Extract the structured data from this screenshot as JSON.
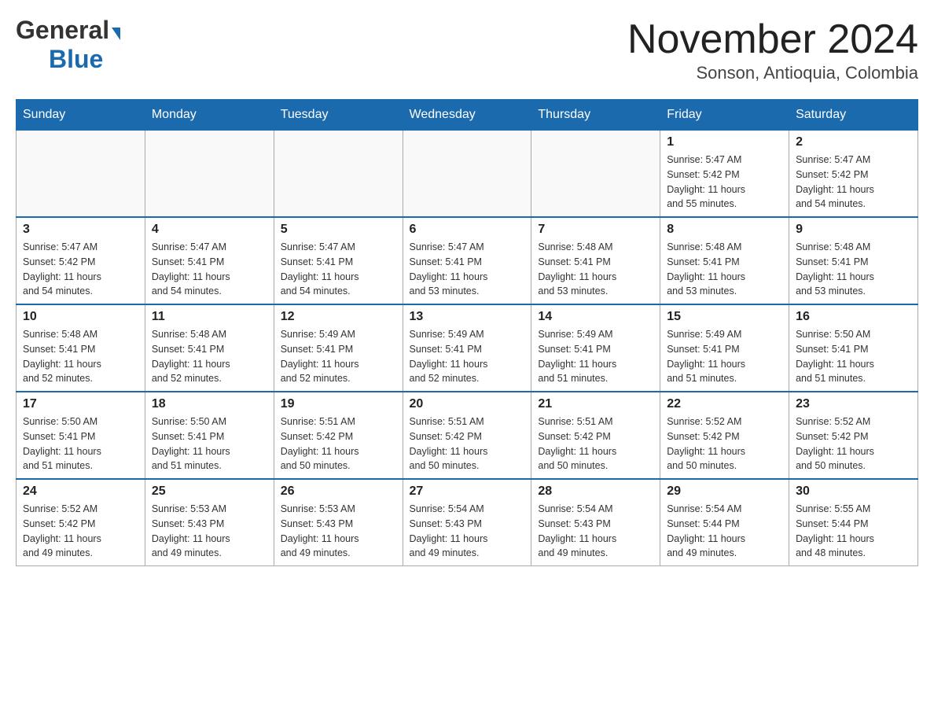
{
  "header": {
    "logo_general": "General",
    "logo_blue": "Blue",
    "month_title": "November 2024",
    "location": "Sonson, Antioquia, Colombia"
  },
  "days_of_week": [
    "Sunday",
    "Monday",
    "Tuesday",
    "Wednesday",
    "Thursday",
    "Friday",
    "Saturday"
  ],
  "weeks": [
    {
      "days": [
        {
          "num": "",
          "info": ""
        },
        {
          "num": "",
          "info": ""
        },
        {
          "num": "",
          "info": ""
        },
        {
          "num": "",
          "info": ""
        },
        {
          "num": "",
          "info": ""
        },
        {
          "num": "1",
          "info": "Sunrise: 5:47 AM\nSunset: 5:42 PM\nDaylight: 11 hours\nand 55 minutes."
        },
        {
          "num": "2",
          "info": "Sunrise: 5:47 AM\nSunset: 5:42 PM\nDaylight: 11 hours\nand 54 minutes."
        }
      ]
    },
    {
      "days": [
        {
          "num": "3",
          "info": "Sunrise: 5:47 AM\nSunset: 5:42 PM\nDaylight: 11 hours\nand 54 minutes."
        },
        {
          "num": "4",
          "info": "Sunrise: 5:47 AM\nSunset: 5:41 PM\nDaylight: 11 hours\nand 54 minutes."
        },
        {
          "num": "5",
          "info": "Sunrise: 5:47 AM\nSunset: 5:41 PM\nDaylight: 11 hours\nand 54 minutes."
        },
        {
          "num": "6",
          "info": "Sunrise: 5:47 AM\nSunset: 5:41 PM\nDaylight: 11 hours\nand 53 minutes."
        },
        {
          "num": "7",
          "info": "Sunrise: 5:48 AM\nSunset: 5:41 PM\nDaylight: 11 hours\nand 53 minutes."
        },
        {
          "num": "8",
          "info": "Sunrise: 5:48 AM\nSunset: 5:41 PM\nDaylight: 11 hours\nand 53 minutes."
        },
        {
          "num": "9",
          "info": "Sunrise: 5:48 AM\nSunset: 5:41 PM\nDaylight: 11 hours\nand 53 minutes."
        }
      ]
    },
    {
      "days": [
        {
          "num": "10",
          "info": "Sunrise: 5:48 AM\nSunset: 5:41 PM\nDaylight: 11 hours\nand 52 minutes."
        },
        {
          "num": "11",
          "info": "Sunrise: 5:48 AM\nSunset: 5:41 PM\nDaylight: 11 hours\nand 52 minutes."
        },
        {
          "num": "12",
          "info": "Sunrise: 5:49 AM\nSunset: 5:41 PM\nDaylight: 11 hours\nand 52 minutes."
        },
        {
          "num": "13",
          "info": "Sunrise: 5:49 AM\nSunset: 5:41 PM\nDaylight: 11 hours\nand 52 minutes."
        },
        {
          "num": "14",
          "info": "Sunrise: 5:49 AM\nSunset: 5:41 PM\nDaylight: 11 hours\nand 51 minutes."
        },
        {
          "num": "15",
          "info": "Sunrise: 5:49 AM\nSunset: 5:41 PM\nDaylight: 11 hours\nand 51 minutes."
        },
        {
          "num": "16",
          "info": "Sunrise: 5:50 AM\nSunset: 5:41 PM\nDaylight: 11 hours\nand 51 minutes."
        }
      ]
    },
    {
      "days": [
        {
          "num": "17",
          "info": "Sunrise: 5:50 AM\nSunset: 5:41 PM\nDaylight: 11 hours\nand 51 minutes."
        },
        {
          "num": "18",
          "info": "Sunrise: 5:50 AM\nSunset: 5:41 PM\nDaylight: 11 hours\nand 51 minutes."
        },
        {
          "num": "19",
          "info": "Sunrise: 5:51 AM\nSunset: 5:42 PM\nDaylight: 11 hours\nand 50 minutes."
        },
        {
          "num": "20",
          "info": "Sunrise: 5:51 AM\nSunset: 5:42 PM\nDaylight: 11 hours\nand 50 minutes."
        },
        {
          "num": "21",
          "info": "Sunrise: 5:51 AM\nSunset: 5:42 PM\nDaylight: 11 hours\nand 50 minutes."
        },
        {
          "num": "22",
          "info": "Sunrise: 5:52 AM\nSunset: 5:42 PM\nDaylight: 11 hours\nand 50 minutes."
        },
        {
          "num": "23",
          "info": "Sunrise: 5:52 AM\nSunset: 5:42 PM\nDaylight: 11 hours\nand 50 minutes."
        }
      ]
    },
    {
      "days": [
        {
          "num": "24",
          "info": "Sunrise: 5:52 AM\nSunset: 5:42 PM\nDaylight: 11 hours\nand 49 minutes."
        },
        {
          "num": "25",
          "info": "Sunrise: 5:53 AM\nSunset: 5:43 PM\nDaylight: 11 hours\nand 49 minutes."
        },
        {
          "num": "26",
          "info": "Sunrise: 5:53 AM\nSunset: 5:43 PM\nDaylight: 11 hours\nand 49 minutes."
        },
        {
          "num": "27",
          "info": "Sunrise: 5:54 AM\nSunset: 5:43 PM\nDaylight: 11 hours\nand 49 minutes."
        },
        {
          "num": "28",
          "info": "Sunrise: 5:54 AM\nSunset: 5:43 PM\nDaylight: 11 hours\nand 49 minutes."
        },
        {
          "num": "29",
          "info": "Sunrise: 5:54 AM\nSunset: 5:44 PM\nDaylight: 11 hours\nand 49 minutes."
        },
        {
          "num": "30",
          "info": "Sunrise: 5:55 AM\nSunset: 5:44 PM\nDaylight: 11 hours\nand 48 minutes."
        }
      ]
    }
  ]
}
